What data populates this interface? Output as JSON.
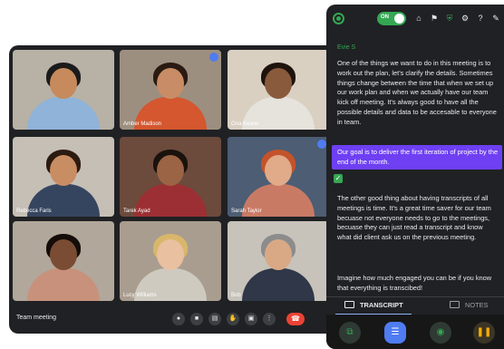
{
  "meet": {
    "title": "Team meeting",
    "participants": [
      {
        "name": "",
        "skin": "#c68a5c",
        "hair": "#1b1b1b",
        "shirt": "#8fb3d9",
        "bg": "#b7b1a6"
      },
      {
        "name": "Amber Madison",
        "skin": "#c88d66",
        "hair": "#2a1a12",
        "shirt": "#d4572f",
        "bg": "#9d8f80"
      },
      {
        "name": "Ona Keane",
        "skin": "#8a5a3c",
        "hair": "#1f140d",
        "shirt": "#e6e2dc",
        "bg": "#d9d0c2"
      },
      {
        "name": "Rebecca Faris",
        "skin": "#c98d63",
        "hair": "#2c1b10",
        "shirt": "#36455f",
        "bg": "#c5bfb6"
      },
      {
        "name": "Tarek Ayad",
        "skin": "#9b6444",
        "hair": "#1a120c",
        "shirt": "#9c2f33",
        "bg": "#6c4a3c"
      },
      {
        "name": "Sarah Taylor",
        "skin": "#e1aa88",
        "hair": "#c4532b",
        "shirt": "#c97a65",
        "bg": "#4c5d74"
      },
      {
        "name": "",
        "skin": "#7a4c33",
        "hair": "#140d09",
        "shirt": "#c8917c",
        "bg": "#b1a79a"
      },
      {
        "name": "Lucy Williams",
        "skin": "#e9c0a0",
        "hair": "#d8b76b",
        "shirt": "#cfcac0",
        "bg": "#a99d8f"
      },
      {
        "name": "Bob",
        "skin": "#d9a985",
        "hair": "#8c8c8c",
        "shirt": "#2f3748",
        "bg": "#c7c2ba"
      }
    ]
  },
  "panel": {
    "toggle_label": "ON",
    "speaker": "Evie S",
    "paragraph_1": "One of the things we want to do in this meeting is to work out the plan, let's clarify the details. Sometimes things change between the time that when we set up our work plan and when we actually have our team kick off meeting. It's always good to have all the possible details and data to be accesable to everyone in team.",
    "highlight": "Our goal is to deliver the first iteration of project by the end of the month.",
    "paragraph_2": "The other good thing about having transcripts of all meetings is time. It's a great time saver for our team becuase not everyone needs to go to the meetings, becuase they can just read a transcript and know what did client ask us on the previous meeting.",
    "paragraph_3": "Imagine how much engaged you can be if you know that everything is transcibed!",
    "tabs": {
      "transcript": "TRANSCRIPT",
      "notes": "NOTES"
    }
  },
  "colors": {
    "accent": "#34a853",
    "highlight": "#6e3ff3",
    "end_call": "#ea4335"
  }
}
